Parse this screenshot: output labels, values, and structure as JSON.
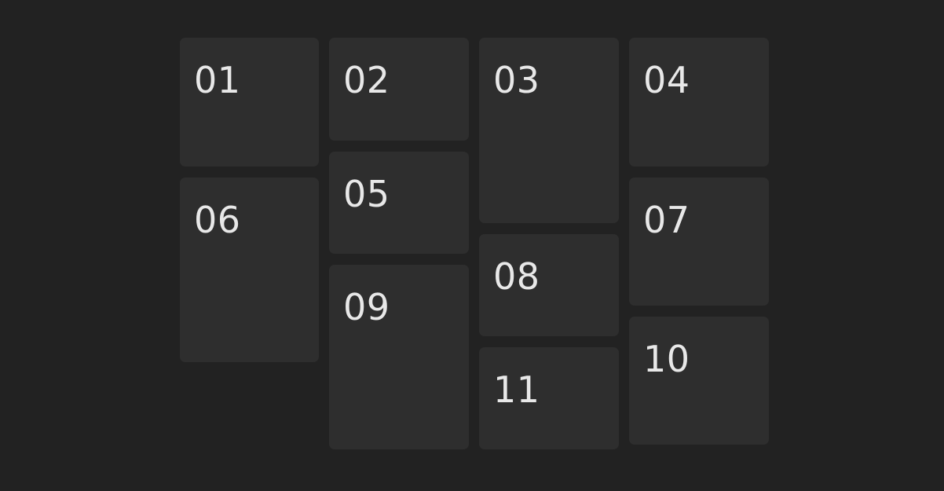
{
  "theme": {
    "background": "#222222",
    "tile": "#2e2e2e",
    "text": "#e8e8e8"
  },
  "tiles": [
    {
      "label": "01"
    },
    {
      "label": "02"
    },
    {
      "label": "03"
    },
    {
      "label": "04"
    },
    {
      "label": "05"
    },
    {
      "label": "06"
    },
    {
      "label": "07"
    },
    {
      "label": "08"
    },
    {
      "label": "09"
    },
    {
      "label": "10"
    },
    {
      "label": "11"
    }
  ]
}
